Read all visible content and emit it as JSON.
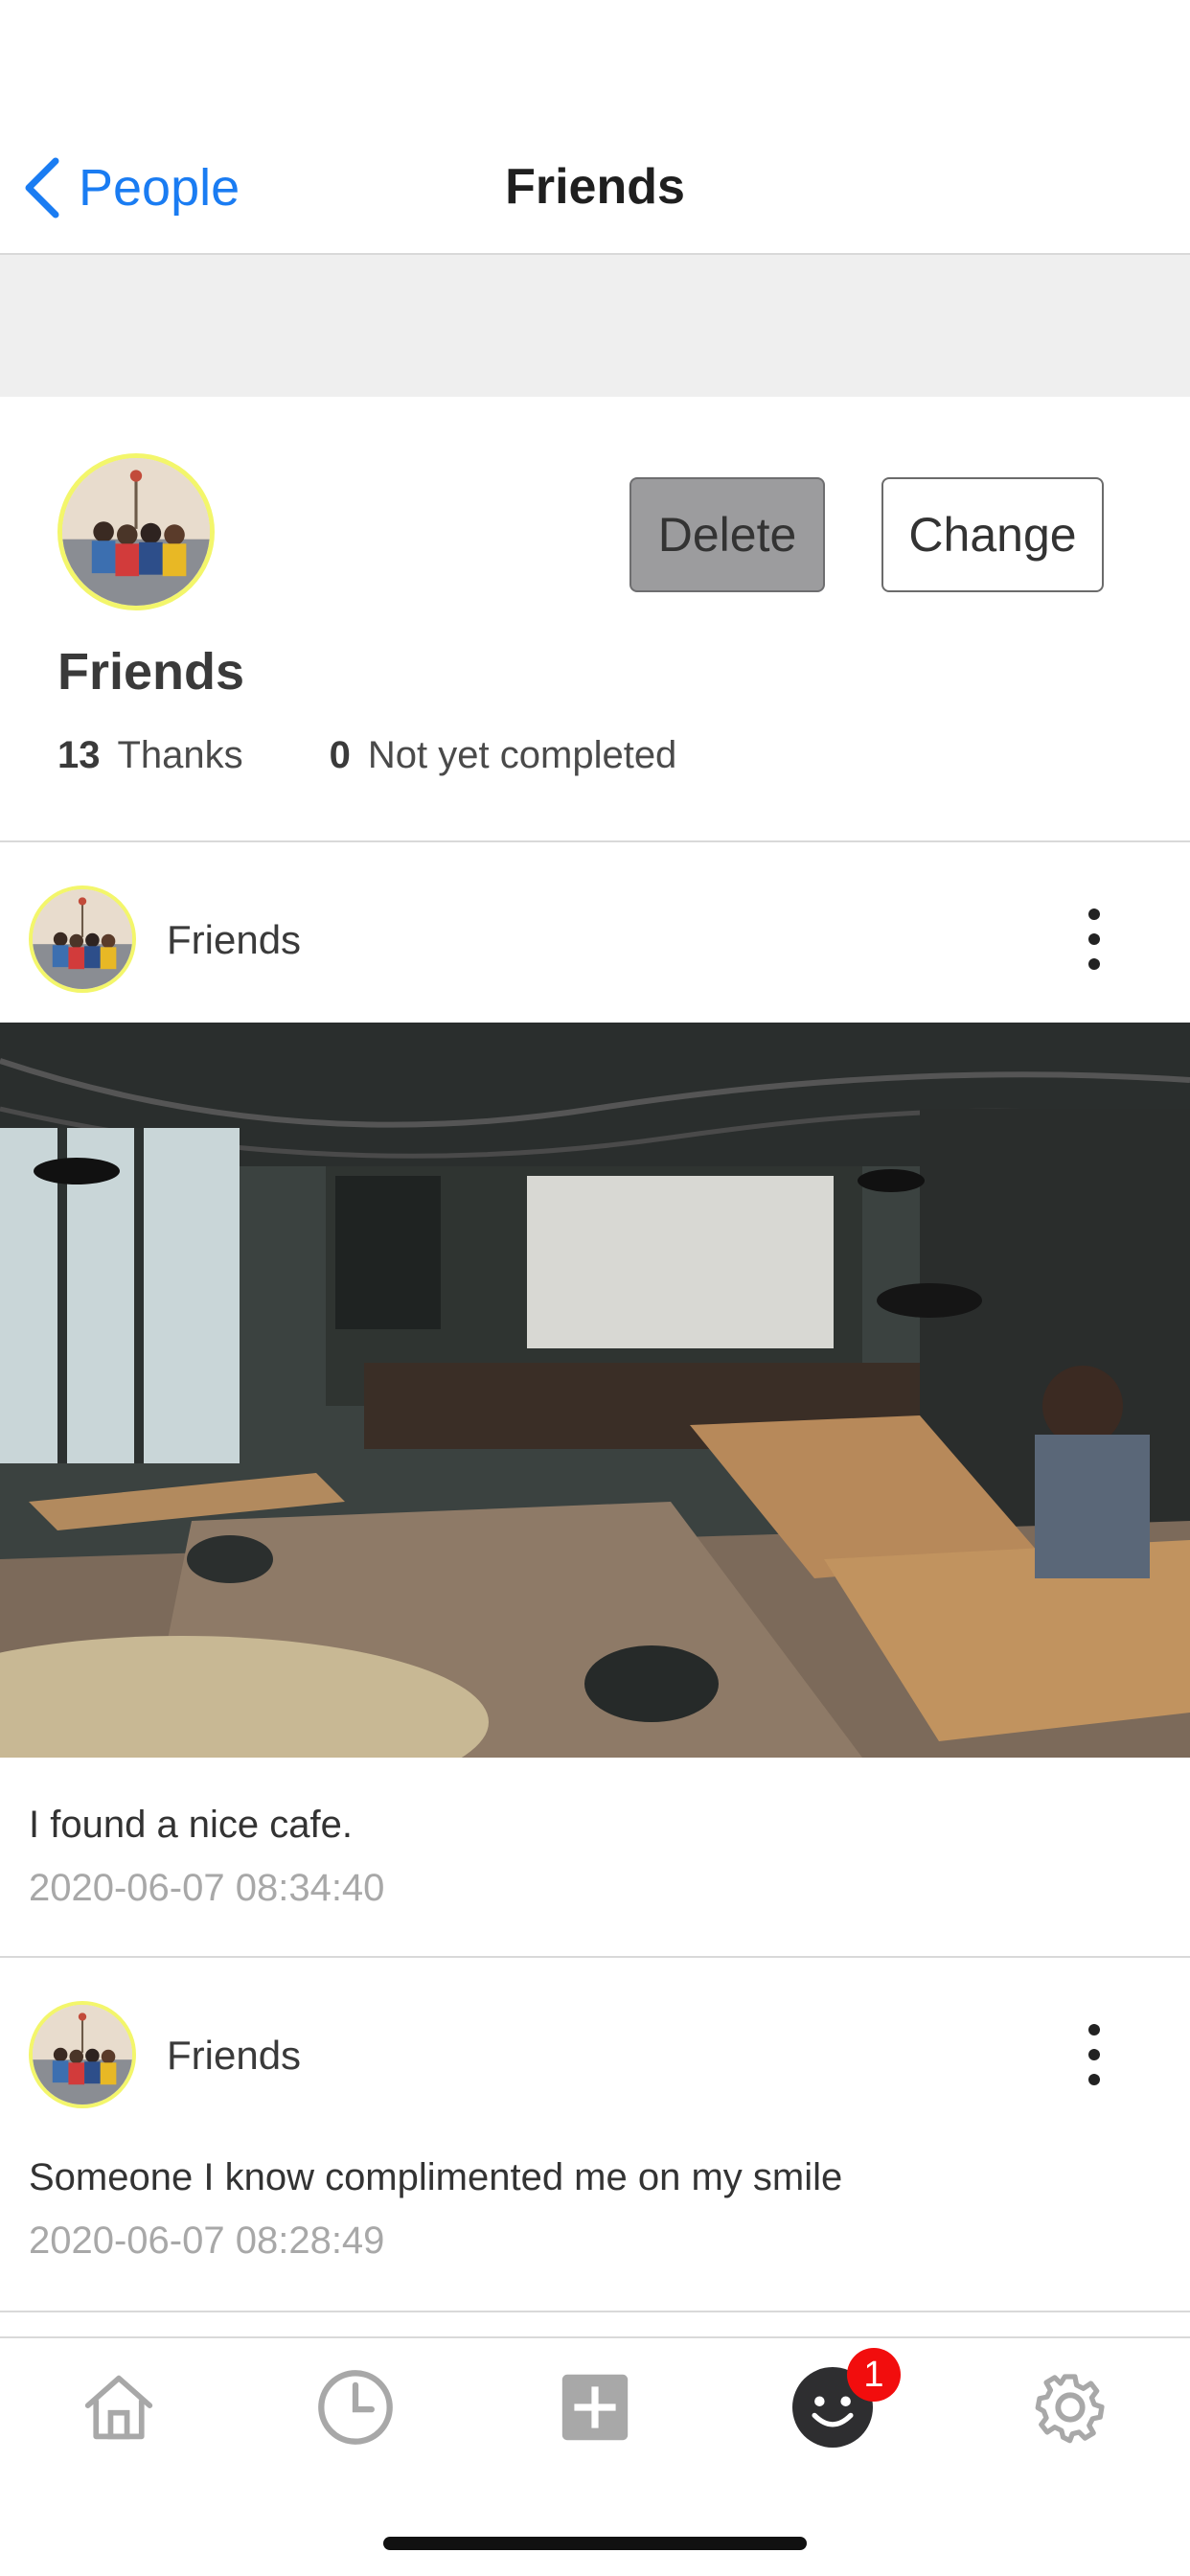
{
  "nav": {
    "back_label": "People",
    "title": "Friends"
  },
  "group": {
    "name": "Friends",
    "delete_label": "Delete",
    "change_label": "Change",
    "thanks_count": "13",
    "thanks_label": "Thanks",
    "incomplete_count": "0",
    "incomplete_label": "Not yet completed"
  },
  "posts": [
    {
      "author": "Friends",
      "text": "I found a nice cafe.",
      "time": "2020-06-07 08:34:40",
      "has_image": true
    },
    {
      "author": "Friends",
      "text": "Someone I know complimented me on my smile",
      "time": "2020-06-07 08:28:49",
      "has_image": false
    }
  ],
  "tabbar": {
    "items": [
      "home-icon",
      "clock-icon",
      "add-icon",
      "smile-icon",
      "gear-icon"
    ],
    "badge": "1",
    "active": "smile-icon"
  },
  "colors": {
    "accent": "#1a7cf2",
    "avatar_ring": "#f3f66b",
    "badge": "#f20d0d",
    "icon_gray": "#a8a8a8"
  }
}
